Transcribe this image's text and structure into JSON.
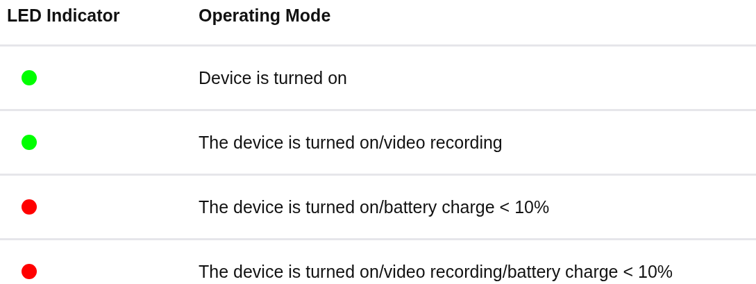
{
  "table": {
    "columns": [
      "LED Indicator",
      "Operating Mode"
    ],
    "rows": [
      {
        "color": "#00ff00",
        "mode": "Device is turned on"
      },
      {
        "color": "#00ff00",
        "mode": "The device is turned on/video recording"
      },
      {
        "color": "#ff0000",
        "mode": "The device is turned on/battery charge < 10%"
      },
      {
        "color": "#ff0000",
        "mode": "The device is turned on/video recording/battery charge < 10%"
      }
    ]
  }
}
